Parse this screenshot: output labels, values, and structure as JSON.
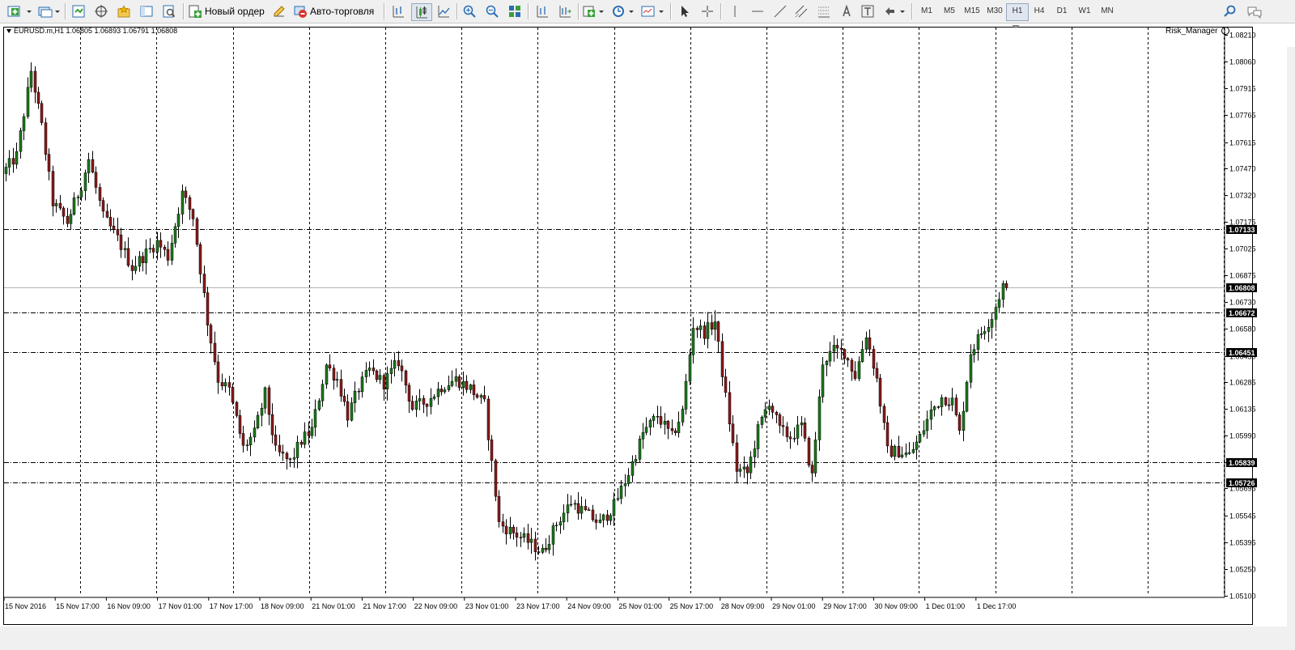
{
  "toolbar": {
    "new_order_label": "Новый ордер",
    "autotrading_label": "Авто-торговля",
    "timeframes": [
      "M1",
      "M5",
      "M15",
      "M30",
      "H1",
      "H4",
      "D1",
      "W1",
      "MN"
    ],
    "active_timeframe": "H1"
  },
  "chart": {
    "symbol_line": "EURUSD.m,H1  1.06805 1.06893 1.06791 1.06808",
    "expert_name": "Risk_Manager",
    "bull_color": "#1b7a1b",
    "bear_color": "#8b1a1a"
  },
  "chart_data": {
    "type": "candlestick",
    "symbol": "EURUSD.m",
    "timeframe": "H1",
    "last_bar": {
      "open": 1.06805,
      "high": 1.06893,
      "low": 1.06791,
      "close": 1.06808
    },
    "y_ticks": [
      1.0821,
      1.0806,
      1.07915,
      1.07765,
      1.07615,
      1.0747,
      1.0732,
      1.07175,
      1.07025,
      1.06875,
      1.0673,
      1.0658,
      1.0643,
      1.06285,
      1.06135,
      1.0599,
      1.0584,
      1.05695,
      1.05545,
      1.05395,
      1.0525,
      1.051
    ],
    "ylim": [
      1.051,
      1.0825
    ],
    "x_labels": [
      "15 Nov 2016",
      "15 Nov 17:00",
      "16 Nov 09:00",
      "17 Nov 01:00",
      "17 Nov 17:00",
      "18 Nov 09:00",
      "21 Nov 01:00",
      "21 Nov 17:00",
      "22 Nov 09:00",
      "23 Nov 01:00",
      "23 Nov 17:00",
      "24 Nov 09:00",
      "25 Nov 01:00",
      "25 Nov 17:00",
      "28 Nov 09:00",
      "29 Nov 01:00",
      "29 Nov 17:00",
      "30 Nov 09:00",
      "1 Dec 01:00",
      "1 Dec 17:00"
    ],
    "horizontal_levels": [
      1.07133,
      1.06672,
      1.06451,
      1.05839,
      1.05726
    ],
    "current_price": 1.06808,
    "grid": true,
    "path_points": [
      {
        "bar": 0,
        "price": 1.0744
      },
      {
        "bar": 4,
        "price": 1.0754
      },
      {
        "bar": 8,
        "price": 1.0801
      },
      {
        "bar": 11,
        "price": 1.077
      },
      {
        "bar": 14,
        "price": 1.0728
      },
      {
        "bar": 18,
        "price": 1.0717
      },
      {
        "bar": 22,
        "price": 1.0738
      },
      {
        "bar": 24,
        "price": 1.0752
      },
      {
        "bar": 28,
        "price": 1.072
      },
      {
        "bar": 32,
        "price": 1.0708
      },
      {
        "bar": 36,
        "price": 1.0692
      },
      {
        "bar": 40,
        "price": 1.07
      },
      {
        "bar": 43,
        "price": 1.0706
      },
      {
        "bar": 46,
        "price": 1.0698
      },
      {
        "bar": 50,
        "price": 1.0733
      },
      {
        "bar": 53,
        "price": 1.072
      },
      {
        "bar": 57,
        "price": 1.0662
      },
      {
        "bar": 60,
        "price": 1.063
      },
      {
        "bar": 63,
        "price": 1.0624
      },
      {
        "bar": 67,
        "price": 1.0592
      },
      {
        "bar": 70,
        "price": 1.06
      },
      {
        "bar": 73,
        "price": 1.0622
      },
      {
        "bar": 76,
        "price": 1.059
      },
      {
        "bar": 80,
        "price": 1.0584
      },
      {
        "bar": 83,
        "price": 1.0596
      },
      {
        "bar": 86,
        "price": 1.0602
      },
      {
        "bar": 90,
        "price": 1.0638
      },
      {
        "bar": 93,
        "price": 1.063
      },
      {
        "bar": 96,
        "price": 1.061
      },
      {
        "bar": 99,
        "price": 1.0625
      },
      {
        "bar": 102,
        "price": 1.0635
      },
      {
        "bar": 106,
        "price": 1.0628
      },
      {
        "bar": 110,
        "price": 1.064
      },
      {
        "bar": 114,
        "price": 1.0614
      },
      {
        "bar": 118,
        "price": 1.0618
      },
      {
        "bar": 122,
        "price": 1.0626
      },
      {
        "bar": 126,
        "price": 1.063
      },
      {
        "bar": 130,
        "price": 1.0625
      },
      {
        "bar": 134,
        "price": 1.0616
      },
      {
        "bar": 138,
        "price": 1.055
      },
      {
        "bar": 142,
        "price": 1.0545
      },
      {
        "bar": 146,
        "price": 1.054
      },
      {
        "bar": 150,
        "price": 1.0534
      },
      {
        "bar": 154,
        "price": 1.055
      },
      {
        "bar": 158,
        "price": 1.0562
      },
      {
        "bar": 162,
        "price": 1.0556
      },
      {
        "bar": 166,
        "price": 1.055
      },
      {
        "bar": 170,
        "price": 1.056
      },
      {
        "bar": 174,
        "price": 1.0578
      },
      {
        "bar": 178,
        "price": 1.06
      },
      {
        "bar": 182,
        "price": 1.061
      },
      {
        "bar": 186,
        "price": 1.0598
      },
      {
        "bar": 189,
        "price": 1.0612
      },
      {
        "bar": 192,
        "price": 1.066
      },
      {
        "bar": 195,
        "price": 1.0656
      },
      {
        "bar": 198,
        "price": 1.0662
      },
      {
        "bar": 201,
        "price": 1.062
      },
      {
        "bar": 204,
        "price": 1.058
      },
      {
        "bar": 207,
        "price": 1.0578
      },
      {
        "bar": 210,
        "price": 1.0602
      },
      {
        "bar": 213,
        "price": 1.0618
      },
      {
        "bar": 216,
        "price": 1.0602
      },
      {
        "bar": 219,
        "price": 1.0598
      },
      {
        "bar": 222,
        "price": 1.0604
      },
      {
        "bar": 225,
        "price": 1.0576
      },
      {
        "bar": 228,
        "price": 1.064
      },
      {
        "bar": 231,
        "price": 1.0646
      },
      {
        "bar": 234,
        "price": 1.0645
      },
      {
        "bar": 237,
        "price": 1.0632
      },
      {
        "bar": 240,
        "price": 1.0655
      },
      {
        "bar": 243,
        "price": 1.063
      },
      {
        "bar": 246,
        "price": 1.059
      },
      {
        "bar": 249,
        "price": 1.059
      },
      {
        "bar": 252,
        "price": 1.0588
      },
      {
        "bar": 255,
        "price": 1.0598
      },
      {
        "bar": 258,
        "price": 1.0612
      },
      {
        "bar": 261,
        "price": 1.062
      },
      {
        "bar": 264,
        "price": 1.0618
      },
      {
        "bar": 266,
        "price": 1.06
      },
      {
        "bar": 269,
        "price": 1.0645
      },
      {
        "bar": 272,
        "price": 1.0656
      },
      {
        "bar": 275,
        "price": 1.0665
      },
      {
        "bar": 278,
        "price": 1.0682
      }
    ]
  }
}
